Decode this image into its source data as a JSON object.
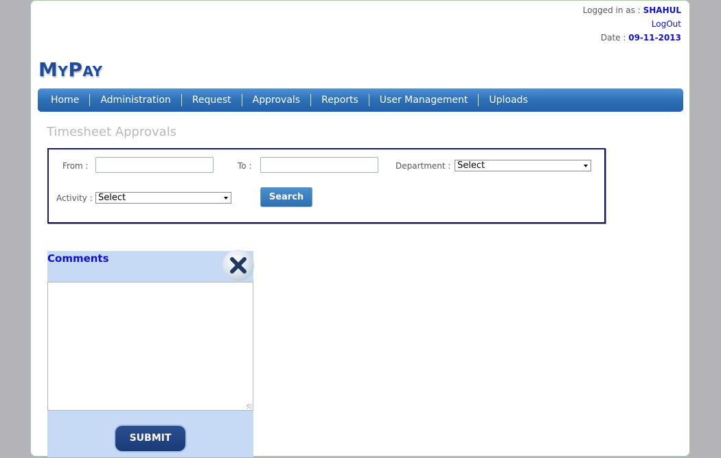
{
  "header": {
    "logged_in_label": "Logged in as : ",
    "username": "SHAHUL",
    "logout_label": "LogOut",
    "date_label": "Date : ",
    "date_value": "09-11-2013"
  },
  "logo": {
    "text_big_m": "M",
    "text_small_y": "Y",
    "text_big_p": "P",
    "text_small_ay": "AY"
  },
  "nav": {
    "items": [
      "Home",
      "Administration",
      "Request",
      "Approvals",
      "Reports",
      "User Management",
      "Uploads"
    ]
  },
  "page": {
    "title": "Timesheet Approvals"
  },
  "filters": {
    "from_label": "From :",
    "to_label": "To :",
    "department_label": "Department :",
    "department_value": "Select",
    "activity_label": "Activity :",
    "activity_value": "Select",
    "search_label": "Search"
  },
  "comments": {
    "title": "Comments",
    "submit_label": "SUBMIT"
  },
  "colors": {
    "accent": "#1010c8",
    "nav_bg": "#2d6fb6",
    "panel_bg": "#c6d9f5"
  }
}
